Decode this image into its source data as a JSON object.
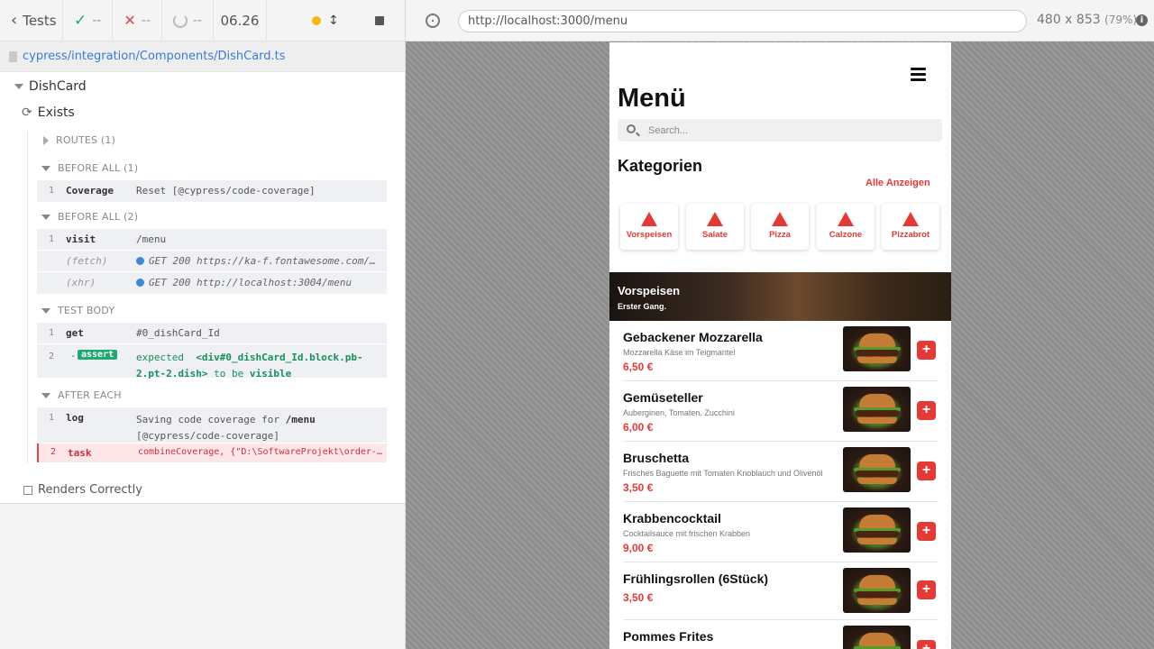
{
  "topbar": {
    "tests_label": "Tests",
    "passed": "--",
    "failed": "--",
    "pending": "--",
    "duration": "06.26"
  },
  "spec": {
    "path": "cypress/integration/Components/DishCard.ts"
  },
  "suite": {
    "title": "DishCard",
    "test_title": "Exists",
    "routes_title": "ROUTES (1)",
    "before_all_1": "BEFORE ALL (1)",
    "before_all_2": "BEFORE ALL (2)",
    "test_body": "TEST BODY",
    "after_each": "AFTER EACH",
    "second_test": "Renders Correctly"
  },
  "commands": {
    "ba1": [
      {
        "num": "1",
        "name": "Coverage",
        "msg": "Reset [@cypress/code-coverage]"
      }
    ],
    "ba2": [
      {
        "num": "1",
        "name": "visit",
        "msg": "/menu"
      },
      {
        "num": "",
        "name": "(fetch)",
        "msg": "GET 200 https://ka-f.fontawesome.com/..."
      },
      {
        "num": "",
        "name": "(xhr)",
        "msg": "GET 200 http://localhost:3004/menu"
      }
    ],
    "body": [
      {
        "num": "1",
        "name": "get",
        "msg": "#0_dishCard_Id"
      },
      {
        "num": "2",
        "badge": "assert",
        "prefix": "-",
        "msg_a": "expected",
        "msg_b": "<div#0_dishCard_Id.block.pb-",
        "msg_c": "2.pt-2.dish>",
        "msg_d": "to be",
        "msg_e": "visible"
      }
    ],
    "after": [
      {
        "num": "1",
        "name": "log",
        "msg_a": "Saving code coverage for",
        "msg_b": "/menu",
        "msg_c": "[@cypress/code-coverage]"
      },
      {
        "num": "2",
        "name": "task",
        "msg": "combineCoverage, {\"D:\\SoftwareProjekt\\order-and..."
      }
    ]
  },
  "aut": {
    "url": "http://localhost:3000/menu",
    "viewport": "480 x 853",
    "scale": "(79%)"
  },
  "app": {
    "title": "Menü",
    "search_placeholder": "Search...",
    "categories_title": "Kategorien",
    "all_link": "Alle Anzeigen",
    "categories": [
      "Vorspeisen",
      "Salate",
      "Pizza",
      "Calzone",
      "Pizzabrot"
    ],
    "section_title": "Vorspeisen",
    "section_subtitle": "Erster Gang.",
    "dishes": [
      {
        "name": "Gebackener Mozzarella",
        "desc": "Mozzarella Käse im Teigmantel",
        "price": "6,50 €"
      },
      {
        "name": "Gemüseteller",
        "desc": "Auberginen, Tomaten, Zucchini",
        "price": "6,00 €"
      },
      {
        "name": "Bruschetta",
        "desc": "Frisches Baguette mit Tomaten Knoblauch und Olivenöl",
        "price": "3,50 €"
      },
      {
        "name": "Krabbencocktail",
        "desc": "Cocktailsauce mit frischen Krabben",
        "price": "9,00 €"
      },
      {
        "name": "Frühlingsrollen (6Stück)",
        "desc": "",
        "price": "3,50 €"
      },
      {
        "name": "Pommes Frites",
        "desc": "",
        "price": ""
      }
    ],
    "add_symbol": "+"
  }
}
